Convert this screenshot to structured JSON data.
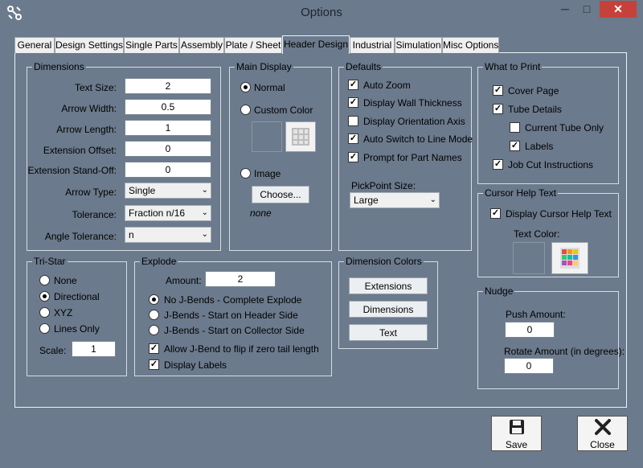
{
  "window": {
    "title": "Options",
    "min_glyph": "─",
    "max_glyph": "□",
    "close_glyph": "✕"
  },
  "tabs": [
    "General",
    "Design Settings",
    "Single Parts",
    "Assembly",
    "Plate / Sheet",
    "Header Design",
    "Industrial",
    "Simulation",
    "Misc Options"
  ],
  "active_tab": "Header Design",
  "dimensions": {
    "title": "Dimensions",
    "text_size_label": "Text Size:",
    "text_size": "2",
    "arrow_width_label": "Arrow Width:",
    "arrow_width": "0.5",
    "arrow_length_label": "Arrow Length:",
    "arrow_length": "1",
    "ext_offset_label": "Extension Offset:",
    "ext_offset": "0",
    "ext_standoff_label": "Extension Stand-Off:",
    "ext_standoff": "0",
    "arrow_type_label": "Arrow Type:",
    "arrow_type": "Single",
    "tolerance_label": "Tolerance:",
    "tolerance": "Fraction n/16",
    "angle_tolerance_label": "Angle Tolerance:",
    "angle_tolerance": "n"
  },
  "main_display": {
    "title": "Main Display",
    "normal": "Normal",
    "custom_color": "Custom Color",
    "image": "Image",
    "choose": "Choose...",
    "image_value": "none"
  },
  "defaults": {
    "title": "Defaults",
    "auto_zoom": "Auto Zoom",
    "wall_thickness": "Display Wall Thickness",
    "orientation_axis": "Display Orientation Axis",
    "line_mode": "Auto Switch to Line Mode",
    "part_names": "Prompt for Part Names",
    "pickpoint_label": "PickPoint Size:",
    "pickpoint_value": "Large"
  },
  "what_to_print": {
    "title": "What to Print",
    "cover_page": "Cover Page",
    "tube_details": "Tube Details",
    "current_tube_only": "Current Tube Only",
    "labels": "Labels",
    "job_cut": "Job Cut Instructions"
  },
  "cursor_help": {
    "title": "Cursor Help Text",
    "display": "Display Cursor Help Text",
    "text_color": "Text Color:"
  },
  "tri_star": {
    "title": "Tri-Star",
    "none": "None",
    "directional": "Directional",
    "xyz": "XYZ",
    "lines_only": "Lines Only",
    "scale_label": "Scale:",
    "scale": "1"
  },
  "explode": {
    "title": "Explode",
    "amount_label": "Amount:",
    "amount": "2",
    "no_jbends": "No J-Bends  - Complete Explode",
    "jbends_header": "J-Bends  - Start on Header Side",
    "jbends_collector": "J-Bends  - Start on Collector Side",
    "allow_flip": "Allow J-Bend to flip if zero tail length",
    "display_labels": "Display Labels"
  },
  "dimension_colors": {
    "title": "Dimension Colors",
    "extensions": "Extensions",
    "dimensions": "Dimensions",
    "text": "Text"
  },
  "nudge": {
    "title": "Nudge",
    "push_label": "Push Amount:",
    "push": "0",
    "rotate_label": "Rotate Amount (in degrees):",
    "rotate": "0"
  },
  "footer": {
    "save": "Save",
    "close": "Close"
  },
  "check_glyph": "✓",
  "chevron_glyph": "⌄",
  "colors": {
    "background": "#6b7a8c",
    "close_red": "#c7413b"
  }
}
